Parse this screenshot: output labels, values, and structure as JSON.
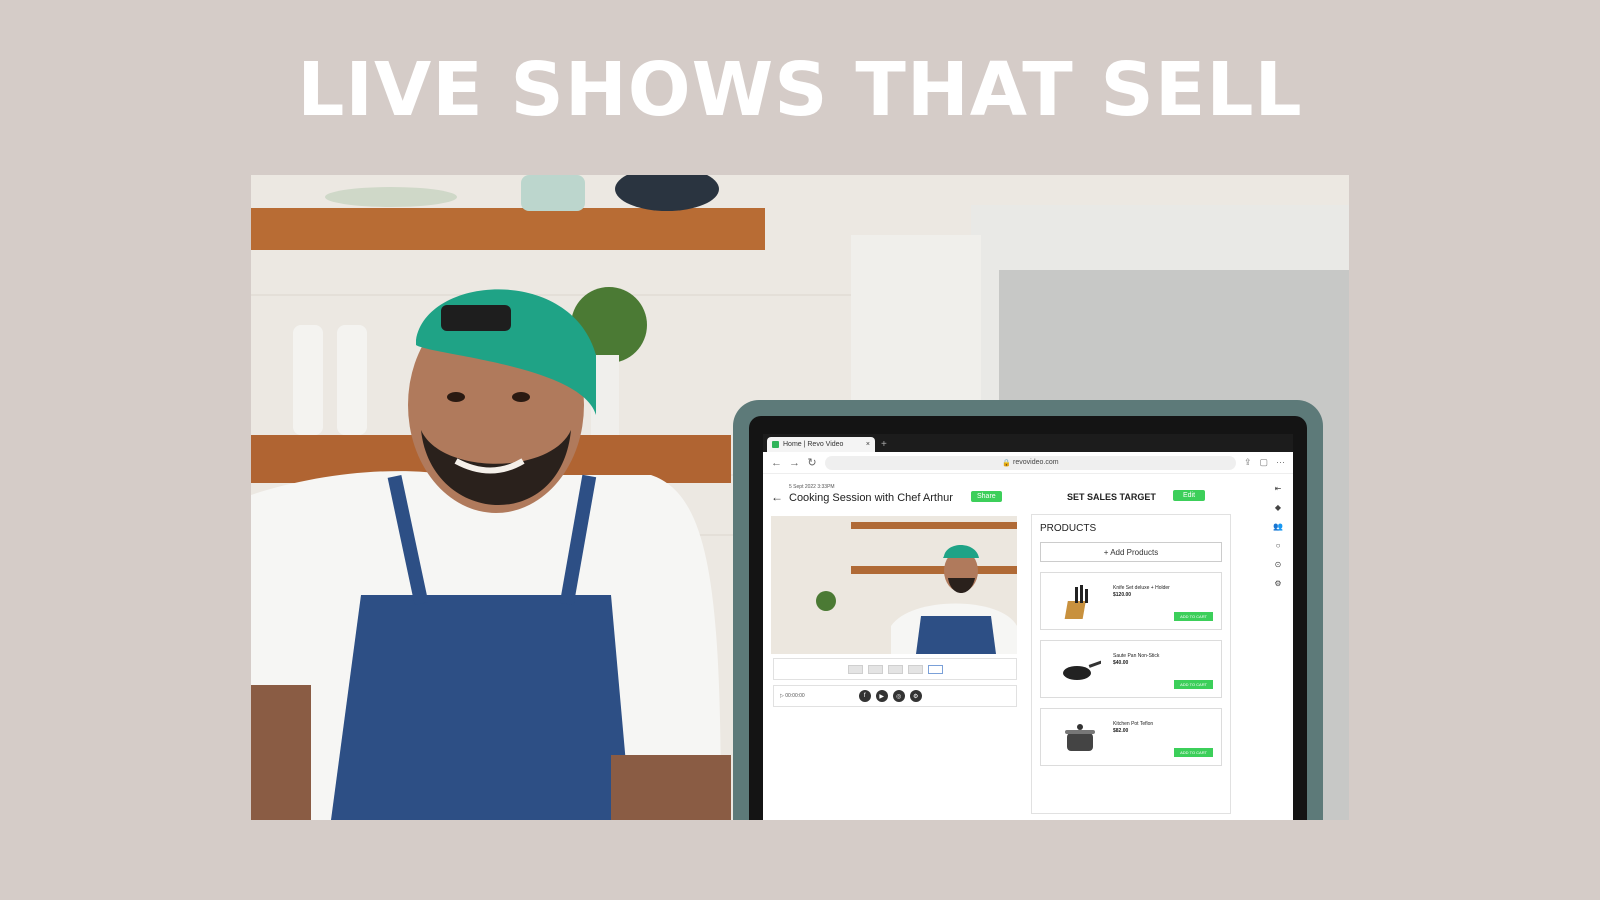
{
  "headline": "LIVE SHOWS THAT SELL",
  "browser": {
    "tab_title": "Home | Revo Video",
    "url": "revovideo.com"
  },
  "dashboard": {
    "date_label": "5 Sept 2022 3:33PM",
    "session_title": "Cooking Session with Chef Arthur",
    "share_label": "Share",
    "sales_target_label": "SET SALES TARGET",
    "edit_label": "Edit",
    "products_heading": "PRODUCTS",
    "add_products_label": "+ Add Products",
    "player_label": "00:00:00",
    "products": [
      {
        "name": "Knife Set deluxe + Holder",
        "price": "$120.00",
        "button": "ADD TO CART"
      },
      {
        "name": "Saute Pan Non-Stick",
        "price": "$40.00",
        "button": "ADD TO CART"
      },
      {
        "name": "Kitchen Pot Teflon",
        "price": "$82.00",
        "button": "ADD TO CART"
      }
    ]
  },
  "colors": {
    "background": "#d5ccc8",
    "accent_green": "#3ccf5a",
    "tablet_case": "#5d7a79"
  }
}
